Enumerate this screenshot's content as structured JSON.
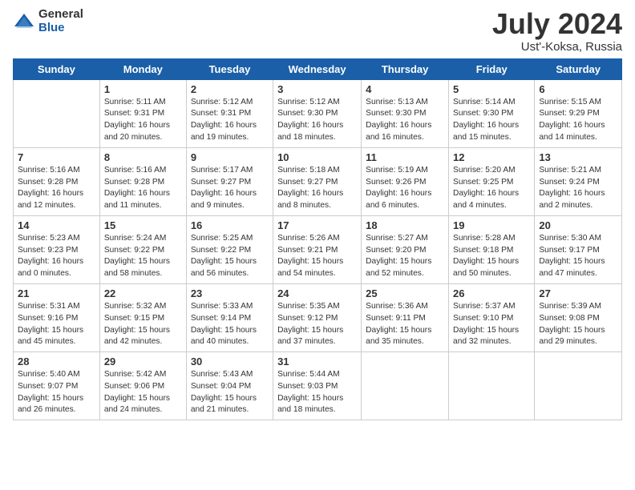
{
  "header": {
    "logo_general": "General",
    "logo_blue": "Blue",
    "title": "July 2024",
    "location": "Ust'-Koksa, Russia"
  },
  "days_of_week": [
    "Sunday",
    "Monday",
    "Tuesday",
    "Wednesday",
    "Thursday",
    "Friday",
    "Saturday"
  ],
  "weeks": [
    [
      {
        "day": "",
        "info": ""
      },
      {
        "day": "1",
        "info": "Sunrise: 5:11 AM\nSunset: 9:31 PM\nDaylight: 16 hours\nand 20 minutes."
      },
      {
        "day": "2",
        "info": "Sunrise: 5:12 AM\nSunset: 9:31 PM\nDaylight: 16 hours\nand 19 minutes."
      },
      {
        "day": "3",
        "info": "Sunrise: 5:12 AM\nSunset: 9:30 PM\nDaylight: 16 hours\nand 18 minutes."
      },
      {
        "day": "4",
        "info": "Sunrise: 5:13 AM\nSunset: 9:30 PM\nDaylight: 16 hours\nand 16 minutes."
      },
      {
        "day": "5",
        "info": "Sunrise: 5:14 AM\nSunset: 9:30 PM\nDaylight: 16 hours\nand 15 minutes."
      },
      {
        "day": "6",
        "info": "Sunrise: 5:15 AM\nSunset: 9:29 PM\nDaylight: 16 hours\nand 14 minutes."
      }
    ],
    [
      {
        "day": "7",
        "info": "Sunrise: 5:16 AM\nSunset: 9:28 PM\nDaylight: 16 hours\nand 12 minutes."
      },
      {
        "day": "8",
        "info": "Sunrise: 5:16 AM\nSunset: 9:28 PM\nDaylight: 16 hours\nand 11 minutes."
      },
      {
        "day": "9",
        "info": "Sunrise: 5:17 AM\nSunset: 9:27 PM\nDaylight: 16 hours\nand 9 minutes."
      },
      {
        "day": "10",
        "info": "Sunrise: 5:18 AM\nSunset: 9:27 PM\nDaylight: 16 hours\nand 8 minutes."
      },
      {
        "day": "11",
        "info": "Sunrise: 5:19 AM\nSunset: 9:26 PM\nDaylight: 16 hours\nand 6 minutes."
      },
      {
        "day": "12",
        "info": "Sunrise: 5:20 AM\nSunset: 9:25 PM\nDaylight: 16 hours\nand 4 minutes."
      },
      {
        "day": "13",
        "info": "Sunrise: 5:21 AM\nSunset: 9:24 PM\nDaylight: 16 hours\nand 2 minutes."
      }
    ],
    [
      {
        "day": "14",
        "info": "Sunrise: 5:23 AM\nSunset: 9:23 PM\nDaylight: 16 hours\nand 0 minutes."
      },
      {
        "day": "15",
        "info": "Sunrise: 5:24 AM\nSunset: 9:22 PM\nDaylight: 15 hours\nand 58 minutes."
      },
      {
        "day": "16",
        "info": "Sunrise: 5:25 AM\nSunset: 9:22 PM\nDaylight: 15 hours\nand 56 minutes."
      },
      {
        "day": "17",
        "info": "Sunrise: 5:26 AM\nSunset: 9:21 PM\nDaylight: 15 hours\nand 54 minutes."
      },
      {
        "day": "18",
        "info": "Sunrise: 5:27 AM\nSunset: 9:20 PM\nDaylight: 15 hours\nand 52 minutes."
      },
      {
        "day": "19",
        "info": "Sunrise: 5:28 AM\nSunset: 9:18 PM\nDaylight: 15 hours\nand 50 minutes."
      },
      {
        "day": "20",
        "info": "Sunrise: 5:30 AM\nSunset: 9:17 PM\nDaylight: 15 hours\nand 47 minutes."
      }
    ],
    [
      {
        "day": "21",
        "info": "Sunrise: 5:31 AM\nSunset: 9:16 PM\nDaylight: 15 hours\nand 45 minutes."
      },
      {
        "day": "22",
        "info": "Sunrise: 5:32 AM\nSunset: 9:15 PM\nDaylight: 15 hours\nand 42 minutes."
      },
      {
        "day": "23",
        "info": "Sunrise: 5:33 AM\nSunset: 9:14 PM\nDaylight: 15 hours\nand 40 minutes."
      },
      {
        "day": "24",
        "info": "Sunrise: 5:35 AM\nSunset: 9:12 PM\nDaylight: 15 hours\nand 37 minutes."
      },
      {
        "day": "25",
        "info": "Sunrise: 5:36 AM\nSunset: 9:11 PM\nDaylight: 15 hours\nand 35 minutes."
      },
      {
        "day": "26",
        "info": "Sunrise: 5:37 AM\nSunset: 9:10 PM\nDaylight: 15 hours\nand 32 minutes."
      },
      {
        "day": "27",
        "info": "Sunrise: 5:39 AM\nSunset: 9:08 PM\nDaylight: 15 hours\nand 29 minutes."
      }
    ],
    [
      {
        "day": "28",
        "info": "Sunrise: 5:40 AM\nSunset: 9:07 PM\nDaylight: 15 hours\nand 26 minutes."
      },
      {
        "day": "29",
        "info": "Sunrise: 5:42 AM\nSunset: 9:06 PM\nDaylight: 15 hours\nand 24 minutes."
      },
      {
        "day": "30",
        "info": "Sunrise: 5:43 AM\nSunset: 9:04 PM\nDaylight: 15 hours\nand 21 minutes."
      },
      {
        "day": "31",
        "info": "Sunrise: 5:44 AM\nSunset: 9:03 PM\nDaylight: 15 hours\nand 18 minutes."
      },
      {
        "day": "",
        "info": ""
      },
      {
        "day": "",
        "info": ""
      },
      {
        "day": "",
        "info": ""
      }
    ]
  ]
}
